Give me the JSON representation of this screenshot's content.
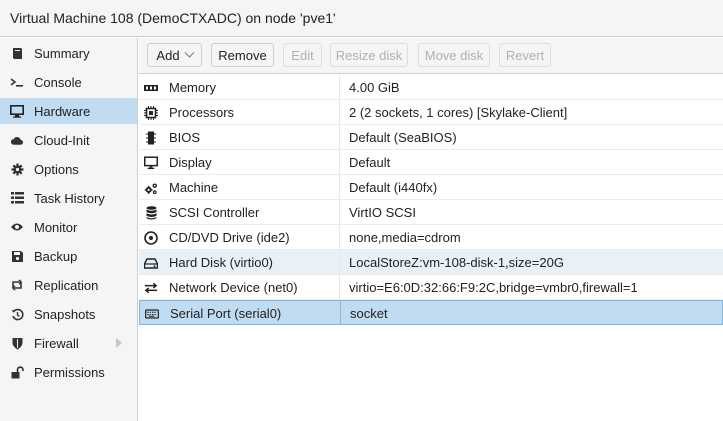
{
  "window": {
    "title": "Virtual Machine 108 (DemoCTXADC) on node 'pve1'"
  },
  "sidebar": {
    "items": [
      {
        "label": "Summary",
        "icon": "book-icon"
      },
      {
        "label": "Console",
        "icon": "terminal-icon"
      },
      {
        "label": "Hardware",
        "icon": "monitor-icon",
        "active": true
      },
      {
        "label": "Cloud-Init",
        "icon": "cloud-icon"
      },
      {
        "label": "Options",
        "icon": "gear-icon"
      },
      {
        "label": "Task History",
        "icon": "list-icon"
      },
      {
        "label": "Monitor",
        "icon": "eye-icon"
      },
      {
        "label": "Backup",
        "icon": "floppy-icon"
      },
      {
        "label": "Replication",
        "icon": "retweet-icon"
      },
      {
        "label": "Snapshots",
        "icon": "history-icon"
      },
      {
        "label": "Firewall",
        "icon": "shield-icon"
      },
      {
        "label": "Permissions",
        "icon": "unlock-icon"
      }
    ]
  },
  "toolbar": {
    "add_label": "Add",
    "remove_label": "Remove",
    "edit_label": "Edit",
    "resize_label": "Resize disk",
    "move_label": "Move disk",
    "revert_label": "Revert"
  },
  "hardware": {
    "rows": [
      {
        "name": "Memory",
        "value": "4.00 GiB",
        "icon": "memory-icon"
      },
      {
        "name": "Processors",
        "value": "2 (2 sockets, 1 cores) [Skylake-Client]",
        "icon": "cpu-icon"
      },
      {
        "name": "BIOS",
        "value": "Default (SeaBIOS)",
        "icon": "microchip-icon"
      },
      {
        "name": "Display",
        "value": "Default",
        "icon": "desktop-icon"
      },
      {
        "name": "Machine",
        "value": "Default (i440fx)",
        "icon": "cogs-icon"
      },
      {
        "name": "SCSI Controller",
        "value": "VirtIO SCSI",
        "icon": "database-icon"
      },
      {
        "name": "CD/DVD Drive (ide2)",
        "value": "none,media=cdrom",
        "icon": "cdrom-icon"
      },
      {
        "name": "Hard Disk (virtio0)",
        "value": "LocalStoreZ:vm-108-disk-1,size=20G",
        "icon": "hdd-icon"
      },
      {
        "name": "Network Device (net0)",
        "value": "virtio=E6:0D:32:66:F9:2C,bridge=vmbr0,firewall=1",
        "icon": "exchange-icon"
      },
      {
        "name": "Serial Port (serial0)",
        "value": "socket",
        "icon": "keyboard-icon"
      }
    ]
  },
  "colors": {
    "selection": "#c1dcf0",
    "hover": "#e8f1f8",
    "toolbar_bg": "#f5f5f5"
  }
}
